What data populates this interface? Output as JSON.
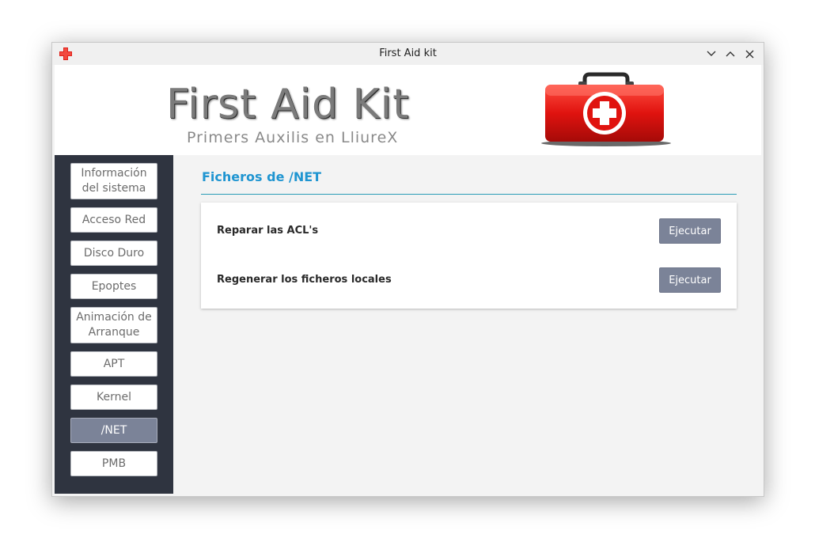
{
  "window": {
    "title": "First Aid kit",
    "controls": [
      "minimize",
      "maximize",
      "close"
    ]
  },
  "banner": {
    "title": "First Aid Kit",
    "subtitle": "Primers Auxilis en LliureX"
  },
  "sidebar": {
    "items": [
      {
        "label": "Información del sistema",
        "active": false
      },
      {
        "label": "Acceso Red",
        "active": false
      },
      {
        "label": "Disco Duro",
        "active": false
      },
      {
        "label": "Epoptes",
        "active": false
      },
      {
        "label": "Animación de Arranque",
        "active": false
      },
      {
        "label": "APT",
        "active": false
      },
      {
        "label": "Kernel",
        "active": false
      },
      {
        "label": "/NET",
        "active": true
      },
      {
        "label": "PMB",
        "active": false
      }
    ]
  },
  "main": {
    "section_title": "Ficheros de /NET",
    "actions": [
      {
        "label": "Reparar las ACL's",
        "button": "Ejecutar"
      },
      {
        "label": "Regenerar los ficheros locales",
        "button": "Ejecutar"
      }
    ]
  },
  "colors": {
    "sidebar_bg": "#2f3440",
    "accent": "#1f95d1",
    "button_bg": "#7b8398",
    "kit_red": "#e0130f"
  }
}
